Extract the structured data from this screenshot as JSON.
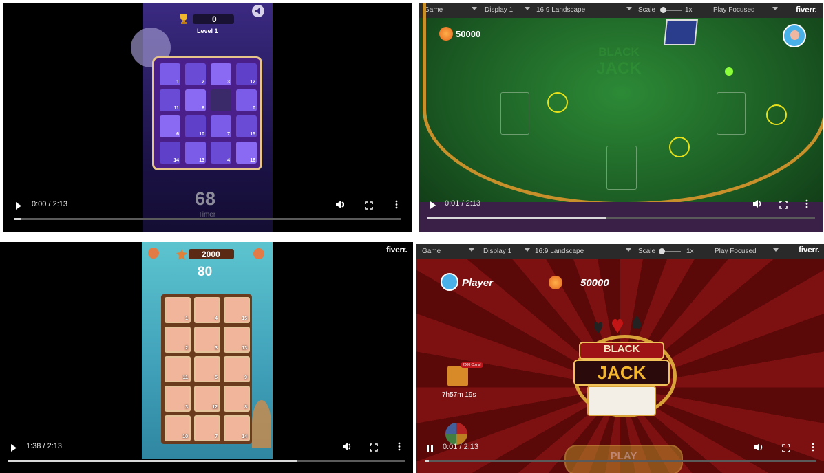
{
  "panels": {
    "top_left": {
      "time": "0:00 / 2:13",
      "progress": 0.02,
      "game": {
        "score": "0",
        "level": "Level 1",
        "timer_value": "68",
        "timer_label": "Timer",
        "tiles": [
          "1",
          "2",
          "3",
          "12",
          "11",
          "8",
          "",
          "0",
          "6",
          "10",
          "7",
          "15",
          "14",
          "13",
          "4",
          "16"
        ]
      }
    },
    "top_right": {
      "time": "0:01 / 2:13",
      "progress": 0.46,
      "toolbar": {
        "game": "Game",
        "display": "Display 1",
        "aspect": "16:9 Landscape",
        "scale_label": "Scale",
        "scale_value": "1x",
        "play_mode": "Play Focused"
      },
      "watermark": "fiverr.",
      "game": {
        "coins": "50000",
        "logo_top": "BLACK",
        "logo_bottom": "JACK"
      }
    },
    "bottom_left": {
      "time": "1:38 / 2:13",
      "progress": 0.73,
      "watermark": "fiverr.",
      "game": {
        "score": "2000",
        "timer_value": "80",
        "tiles": [
          "1",
          "4",
          "15",
          "2",
          "3",
          "13",
          "11",
          "5",
          "9",
          "3",
          "12",
          "8",
          "10",
          "7",
          "14"
        ]
      }
    },
    "bottom_right": {
      "time": "0:01 / 2:13",
      "progress": 0.01,
      "toolbar": {
        "game": "Game",
        "display": "Display 1",
        "aspect": "16:9 Landscape",
        "scale_label": "Scale",
        "scale_value": "1x",
        "play_mode": "Play Focused"
      },
      "watermark": "fiverr.",
      "game": {
        "player_label": "Player",
        "coins": "50000",
        "gift_badge": "2000 Coins!",
        "countdown": "7h57m 19s",
        "logo_top": "BLACK",
        "logo_bottom": "JACK",
        "play_button": "PLAY"
      }
    }
  },
  "colors": {
    "felt": "#1f6a2a",
    "purple_bg": "#2a1b5e",
    "teal_bg": "#4fb9c7",
    "red_bg": "#6a0d0d",
    "gold": "#d9a33a"
  }
}
